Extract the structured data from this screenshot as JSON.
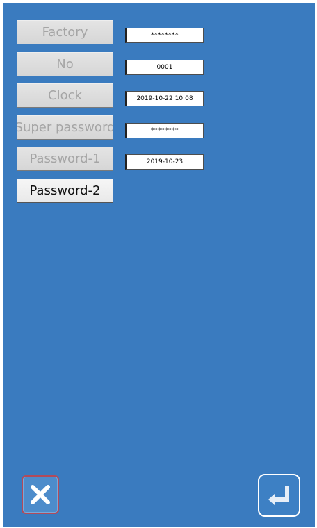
{
  "rows": [
    {
      "label": "Factory",
      "value": "********",
      "active": false
    },
    {
      "label": "No",
      "value": "0001",
      "active": false
    },
    {
      "label": "Clock",
      "value": "2019-10-22 10:08",
      "active": false
    },
    {
      "label": "Super password",
      "value": "********",
      "active": false
    },
    {
      "label": "Password-1",
      "value": "2019-10-23",
      "active": false
    },
    {
      "label": "Password-2",
      "active": true
    }
  ],
  "footer": {
    "close_icon": "close-icon",
    "enter_icon": "enter-return-icon"
  },
  "colors": {
    "background": "#3a7bbf",
    "button_disabled_text": "#a5a5a5",
    "button_active_text": "#111111"
  }
}
